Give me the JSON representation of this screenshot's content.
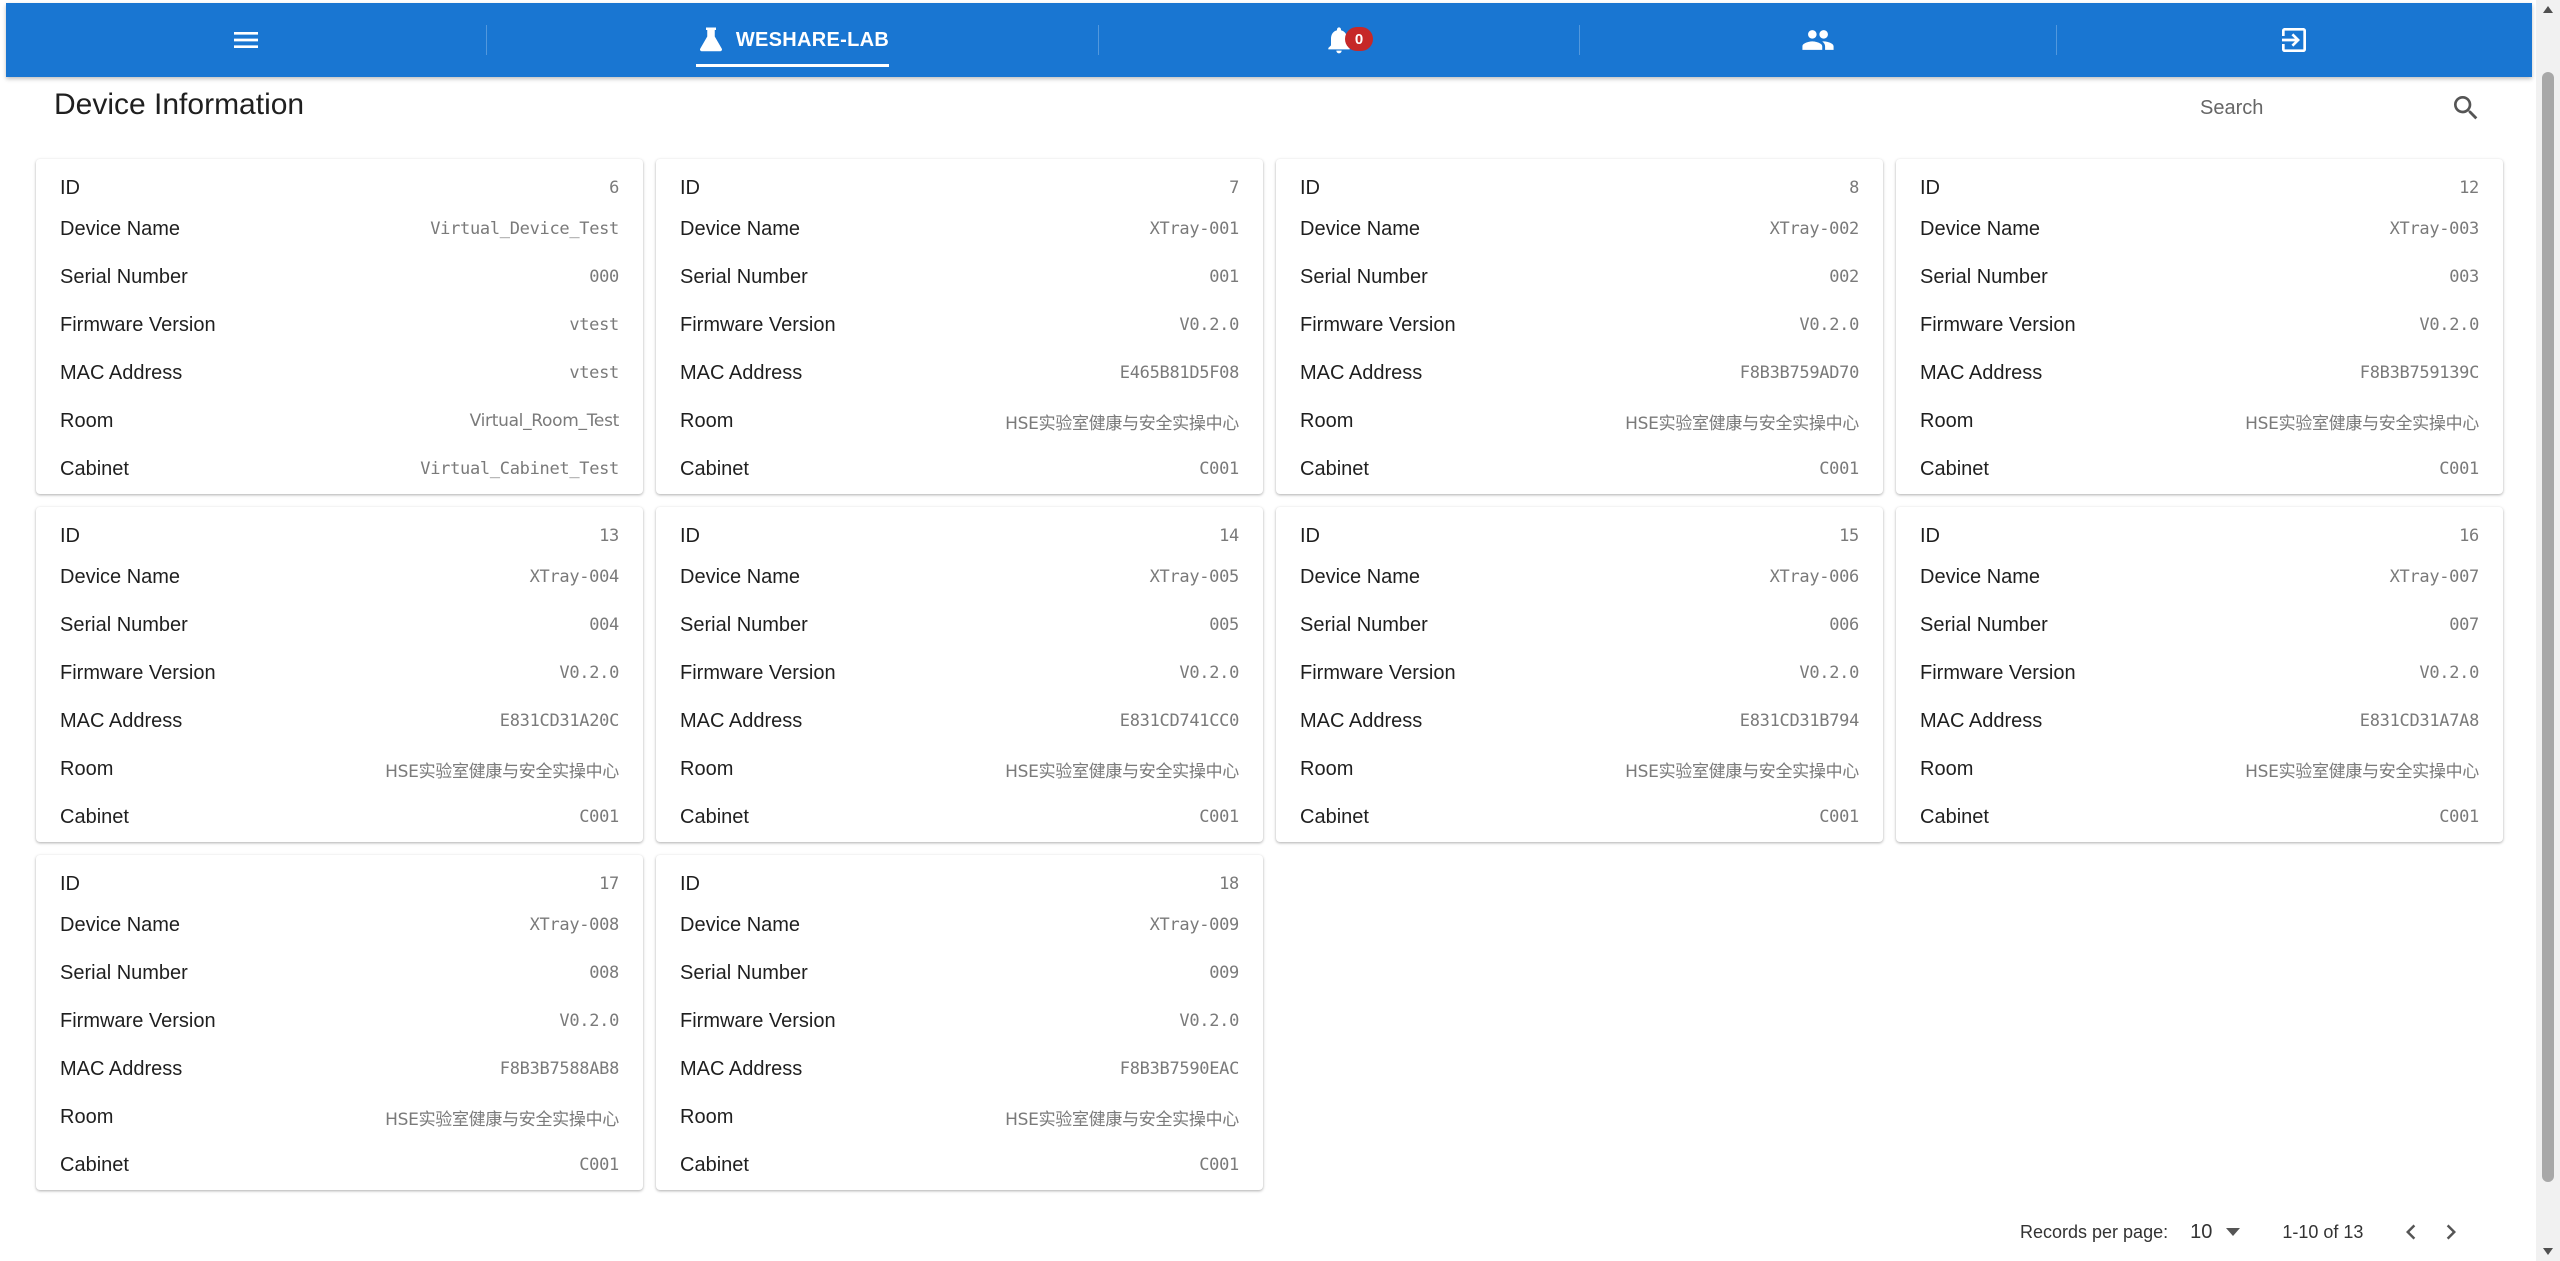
{
  "appbar": {
    "brand_label": "WESHARE-LAB",
    "notification_count": "0",
    "color": "#1976d2"
  },
  "page": {
    "title": "Device Information",
    "search_placeholder": "Search"
  },
  "labels": {
    "id": "ID",
    "device_name": "Device Name",
    "serial_number": "Serial Number",
    "firmware_version": "Firmware Version",
    "mac_address": "MAC Address",
    "room": "Room",
    "cabinet": "Cabinet"
  },
  "devices": [
    {
      "id": "6",
      "device_name": "Virtual_Device_Test",
      "serial_number": "000",
      "firmware_version": "vtest",
      "mac_address": "vtest",
      "room": "Virtual_Room_Test",
      "cabinet": "Virtual_Cabinet_Test"
    },
    {
      "id": "7",
      "device_name": "XTray-001",
      "serial_number": "001",
      "firmware_version": "V0.2.0",
      "mac_address": "E465B81D5F08",
      "room": "HSE实验室健康与安全实操中心",
      "cabinet": "C001"
    },
    {
      "id": "8",
      "device_name": "XTray-002",
      "serial_number": "002",
      "firmware_version": "V0.2.0",
      "mac_address": "F8B3B759AD70",
      "room": "HSE实验室健康与安全实操中心",
      "cabinet": "C001"
    },
    {
      "id": "12",
      "device_name": "XTray-003",
      "serial_number": "003",
      "firmware_version": "V0.2.0",
      "mac_address": "F8B3B759139C",
      "room": "HSE实验室健康与安全实操中心",
      "cabinet": "C001"
    },
    {
      "id": "13",
      "device_name": "XTray-004",
      "serial_number": "004",
      "firmware_version": "V0.2.0",
      "mac_address": "E831CD31A20C",
      "room": "HSE实验室健康与安全实操中心",
      "cabinet": "C001"
    },
    {
      "id": "14",
      "device_name": "XTray-005",
      "serial_number": "005",
      "firmware_version": "V0.2.0",
      "mac_address": "E831CD741CC0",
      "room": "HSE实验室健康与安全实操中心",
      "cabinet": "C001"
    },
    {
      "id": "15",
      "device_name": "XTray-006",
      "serial_number": "006",
      "firmware_version": "V0.2.0",
      "mac_address": "E831CD31B794",
      "room": "HSE实验室健康与安全实操中心",
      "cabinet": "C001"
    },
    {
      "id": "16",
      "device_name": "XTray-007",
      "serial_number": "007",
      "firmware_version": "V0.2.0",
      "mac_address": "E831CD31A7A8",
      "room": "HSE实验室健康与安全实操中心",
      "cabinet": "C001"
    },
    {
      "id": "17",
      "device_name": "XTray-008",
      "serial_number": "008",
      "firmware_version": "V0.2.0",
      "mac_address": "F8B3B7588AB8",
      "room": "HSE实验室健康与安全实操中心",
      "cabinet": "C001"
    },
    {
      "id": "18",
      "device_name": "XTray-009",
      "serial_number": "009",
      "firmware_version": "V0.2.0",
      "mac_address": "F8B3B7590EAC",
      "room": "HSE实验室健康与安全实操中心",
      "cabinet": "C001"
    }
  ],
  "pagination": {
    "records_per_page_label": "Records per page:",
    "records_per_page_value": "10",
    "range_text": "1-10 of 13"
  }
}
